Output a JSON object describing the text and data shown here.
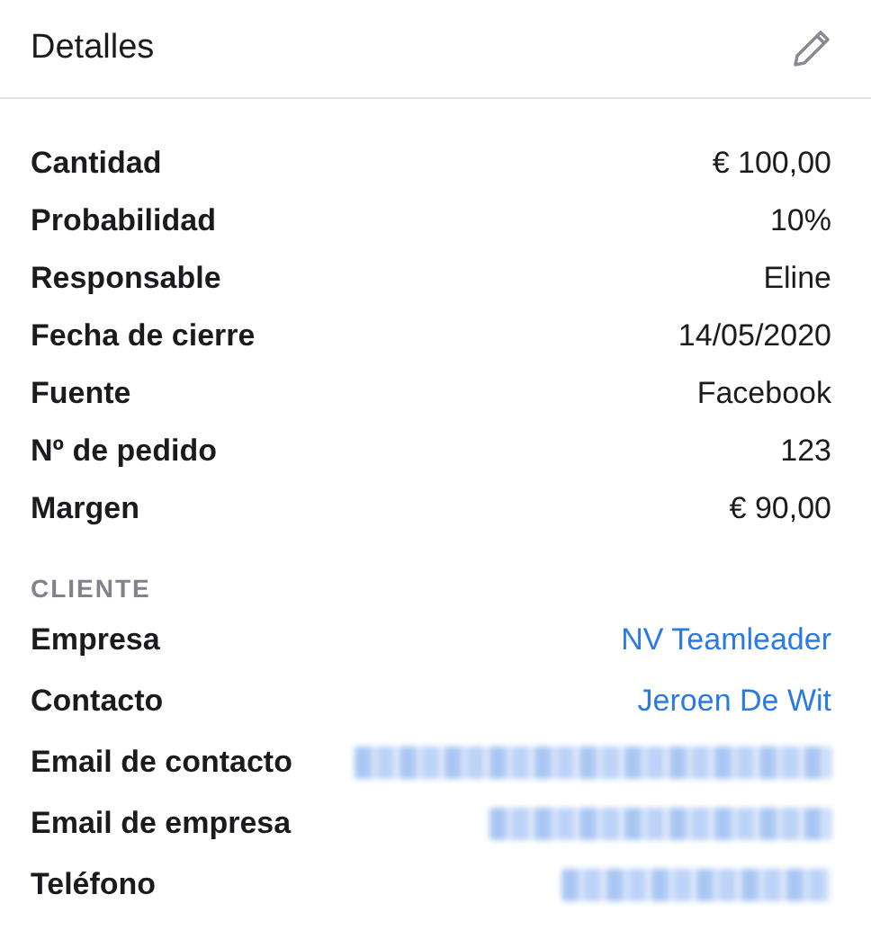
{
  "header": {
    "title": "Detalles"
  },
  "details": [
    {
      "label": "Cantidad",
      "value": "€ 100,00"
    },
    {
      "label": "Probabilidad",
      "value": "10%"
    },
    {
      "label": "Responsable",
      "value": "Eline"
    },
    {
      "label": "Fecha de cierre",
      "value": "14/05/2020"
    },
    {
      "label": "Fuente",
      "value": "Facebook"
    },
    {
      "label": "Nº de pedido",
      "value": "123"
    },
    {
      "label": "Margen",
      "value": "€ 90,00"
    }
  ],
  "client": {
    "heading": "CLIENTE",
    "rows": [
      {
        "label": "Empresa",
        "kind": "link",
        "value": "NV Teamleader"
      },
      {
        "label": "Contacto",
        "kind": "link",
        "value": "Jeroen De Wit"
      },
      {
        "label": "Email de contacto",
        "kind": "redacted"
      },
      {
        "label": "Email de empresa",
        "kind": "redacted"
      },
      {
        "label": "Teléfono",
        "kind": "redacted"
      }
    ]
  }
}
